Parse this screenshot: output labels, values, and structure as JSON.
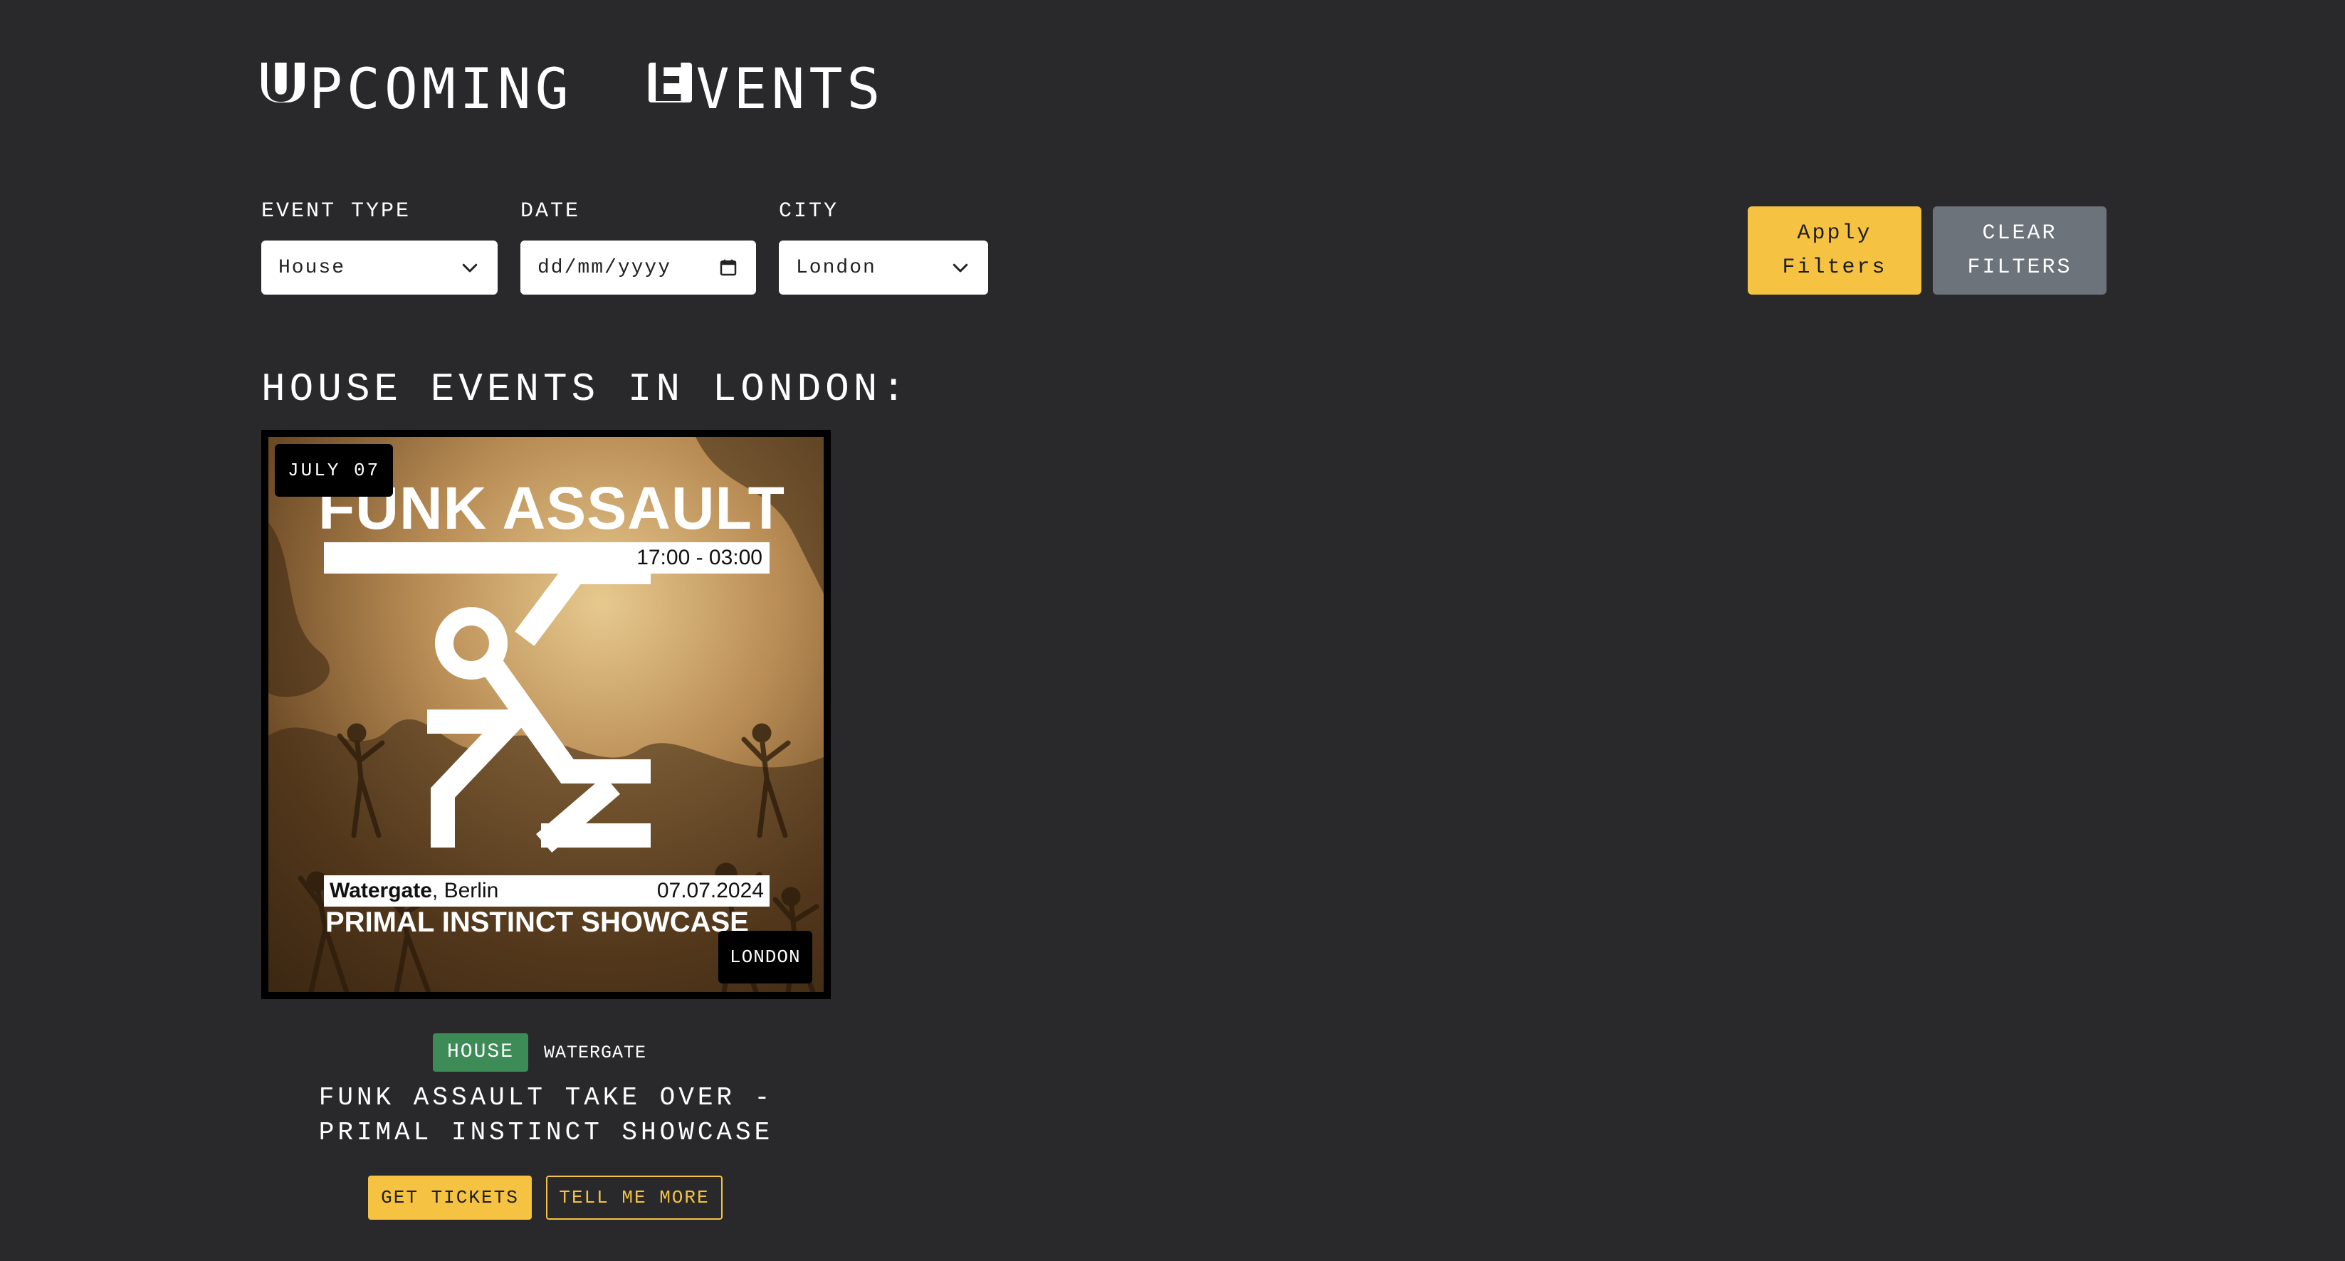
{
  "page": {
    "title_initial_1": "U",
    "title_rest_1": "PCOMING",
    "title_initial_2": "E",
    "title_rest_2": "VENTS"
  },
  "filters": {
    "event_type_label": "EVENT TYPE",
    "event_type_value": "House",
    "date_label": "DATE",
    "date_placeholder": "dd/mm/yyyy",
    "city_label": "CITY",
    "city_value": "London",
    "apply_label": "Apply Filters",
    "clear_label": "CLEAR FILTERS"
  },
  "results": {
    "heading": "HOUSE EVENTS IN LONDON:"
  },
  "event": {
    "date_badge": "JULY 07",
    "city_badge": "LONDON",
    "poster": {
      "title": "FUNK ASSAULT",
      "time": "17:00 - 03:00",
      "venue_bold": "Watergate",
      "venue_rest": ", Berlin",
      "date": "07.07.2024",
      "showcase": "PRIMAL INSTINCT SHOWCASE"
    },
    "genre": "HOUSE",
    "venue": "WATERGATE",
    "title": "FUNK ASSAULT TAKE OVER - PRIMAL INSTINCT SHOWCASE",
    "tickets_label": "GET TICKETS",
    "more_label": "TELL ME MORE"
  },
  "colors": {
    "background": "#29292b",
    "accent_yellow": "#f5c242",
    "clear_gray": "#6c737b",
    "genre_green": "#3d8b57"
  },
  "icons": {
    "select_arrow": "chevron-down-icon",
    "date_picker": "calendar-icon"
  }
}
